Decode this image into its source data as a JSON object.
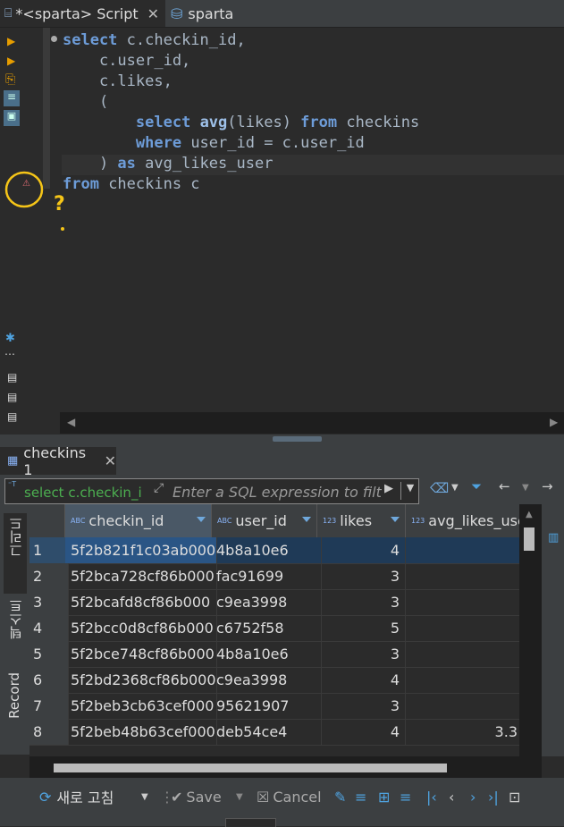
{
  "tabs": [
    {
      "label": "*<sparta> Script",
      "active": true
    },
    {
      "label": "sparta",
      "active": false
    }
  ],
  "editor": {
    "lines": [
      [
        {
          "t": "select",
          "k": "kw"
        },
        {
          "t": " c.checkin_id,",
          "k": "id"
        }
      ],
      [
        {
          "t": "    c.user_id,",
          "k": "id"
        }
      ],
      [
        {
          "t": "    c.likes,",
          "k": "id"
        }
      ],
      [
        {
          "t": "    (",
          "k": "id"
        }
      ],
      [
        {
          "t": "        ",
          "k": "id"
        },
        {
          "t": "select",
          "k": "kw"
        },
        {
          "t": " ",
          "k": "id"
        },
        {
          "t": "avg",
          "k": "fn"
        },
        {
          "t": "(likes) ",
          "k": "id"
        },
        {
          "t": "from",
          "k": "kw"
        },
        {
          "t": " checkins",
          "k": "id"
        }
      ],
      [
        {
          "t": "        ",
          "k": "id"
        },
        {
          "t": "where",
          "k": "kw"
        },
        {
          "t": " user_id = c.user_id",
          "k": "id"
        }
      ],
      [
        {
          "t": "    ) ",
          "k": "id"
        },
        {
          "t": "as",
          "k": "kw"
        },
        {
          "t": " avg_likes_user",
          "k": "id"
        }
      ],
      [
        {
          "t": "from",
          "k": "kw"
        },
        {
          "t": " checkins c",
          "k": "id"
        }
      ]
    ]
  },
  "results": {
    "tab_label": "checkins 1",
    "filter_prefix": "select c.checkin_i",
    "filter_placeholder": "Enter a SQL expression to filter",
    "columns": [
      {
        "type": "ABC",
        "name": "checkin_id"
      },
      {
        "type": "ABC",
        "name": "user_id"
      },
      {
        "type": "123",
        "name": "likes"
      },
      {
        "type": "123",
        "name": "avg_likes_user"
      }
    ],
    "rows": [
      {
        "n": "1",
        "checkin_id": "5f2b821f1c03ab000",
        "user_id": "4b8a10e6",
        "likes": "4",
        "avg": ""
      },
      {
        "n": "2",
        "checkin_id": "5f2bca728cf86b000",
        "user_id": "fac91699",
        "likes": "3",
        "avg": ""
      },
      {
        "n": "3",
        "checkin_id": "5f2bcafd8cf86b000",
        "user_id": "c9ea3998",
        "likes": "3",
        "avg": ""
      },
      {
        "n": "4",
        "checkin_id": "5f2bcc0d8cf86b000",
        "user_id": "c6752f58",
        "likes": "5",
        "avg": ""
      },
      {
        "n": "5",
        "checkin_id": "5f2bce748cf86b000",
        "user_id": "4b8a10e6",
        "likes": "3",
        "avg": ""
      },
      {
        "n": "6",
        "checkin_id": "5f2bd2368cf86b000",
        "user_id": "c9ea3998",
        "likes": "4",
        "avg": ""
      },
      {
        "n": "7",
        "checkin_id": "5f2beb3cb63cef000",
        "user_id": "95621907",
        "likes": "3",
        "avg": ""
      },
      {
        "n": "8",
        "checkin_id": "5f2beb48b63cef000",
        "user_id": "deb54ce4",
        "likes": "4",
        "avg": "3.3"
      }
    ],
    "side_tabs": [
      "그리드",
      "텍스트",
      "Record"
    ]
  },
  "bottom": {
    "refresh": "새로 고침",
    "save": "Save",
    "cancel": "Cancel"
  },
  "colors": {
    "selected_row": "#1f3a57",
    "annotation": "#f5c518",
    "keyword": "#6d9cd8"
  }
}
